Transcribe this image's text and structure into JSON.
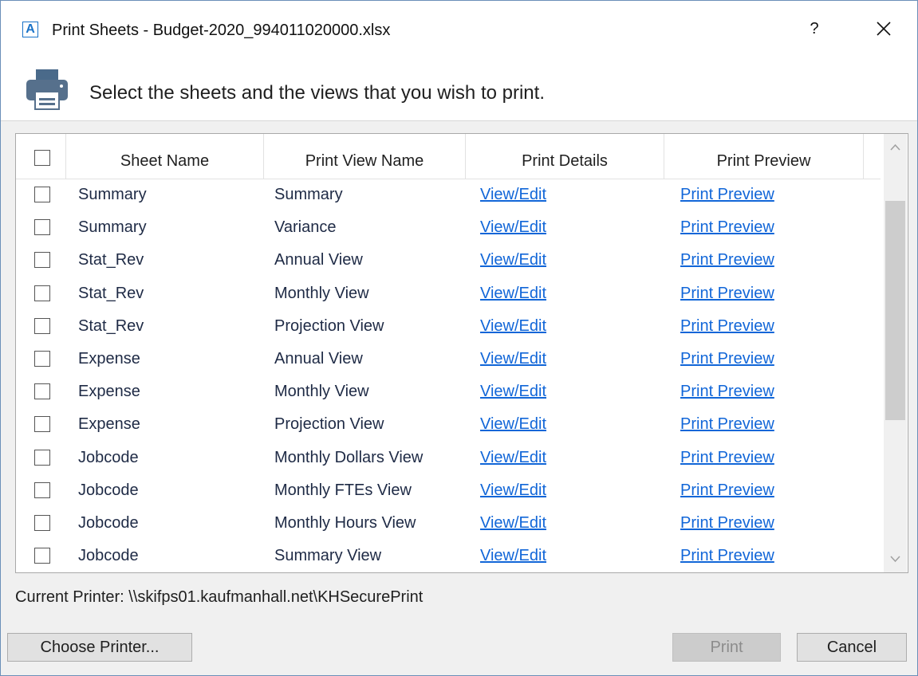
{
  "window": {
    "app_icon_letter": "A",
    "title": "Print Sheets - Budget-2020_994011020000.xlsx",
    "help_label": "?"
  },
  "header": {
    "instruction": "Select the sheets and the views that you wish to print."
  },
  "table": {
    "columns": [
      "Sheet Name",
      "Print View Name",
      "Print Details",
      "Print Preview"
    ],
    "rows": [
      {
        "sheet": "Summary",
        "view": "Summary",
        "details": "View/Edit",
        "preview": "Print Preview"
      },
      {
        "sheet": "Summary",
        "view": "Variance",
        "details": "View/Edit",
        "preview": "Print Preview"
      },
      {
        "sheet": "Stat_Rev",
        "view": "Annual View",
        "details": "View/Edit",
        "preview": "Print Preview"
      },
      {
        "sheet": "Stat_Rev",
        "view": "Monthly View",
        "details": "View/Edit",
        "preview": "Print Preview"
      },
      {
        "sheet": "Stat_Rev",
        "view": "Projection View",
        "details": "View/Edit",
        "preview": "Print Preview"
      },
      {
        "sheet": "Expense",
        "view": "Annual View",
        "details": "View/Edit",
        "preview": "Print Preview"
      },
      {
        "sheet": "Expense",
        "view": "Monthly View",
        "details": "View/Edit",
        "preview": "Print Preview"
      },
      {
        "sheet": "Expense",
        "view": "Projection View",
        "details": "View/Edit",
        "preview": "Print Preview"
      },
      {
        "sheet": "Jobcode",
        "view": "Monthly Dollars View",
        "details": "View/Edit",
        "preview": "Print Preview"
      },
      {
        "sheet": "Jobcode",
        "view": "Monthly FTEs View",
        "details": "View/Edit",
        "preview": "Print Preview"
      },
      {
        "sheet": "Jobcode",
        "view": "Monthly Hours View",
        "details": "View/Edit",
        "preview": "Print Preview"
      },
      {
        "sheet": "Jobcode",
        "view": "Summary View",
        "details": "View/Edit",
        "preview": "Print Preview"
      }
    ]
  },
  "footer": {
    "current_printer": "Current Printer: \\\\skifps01.kaufmanhall.net\\KHSecurePrint",
    "choose_printer_label": "Choose Printer...",
    "print_label": "Print",
    "cancel_label": "Cancel"
  },
  "colors": {
    "link": "#1166d8",
    "app_icon": "#1a73c8",
    "disabled_text": "#8c8c8c"
  },
  "icons": [
    "app-logo-icon",
    "help-icon",
    "close-icon",
    "printer-icon",
    "chevron-up-icon",
    "chevron-down-icon"
  ]
}
